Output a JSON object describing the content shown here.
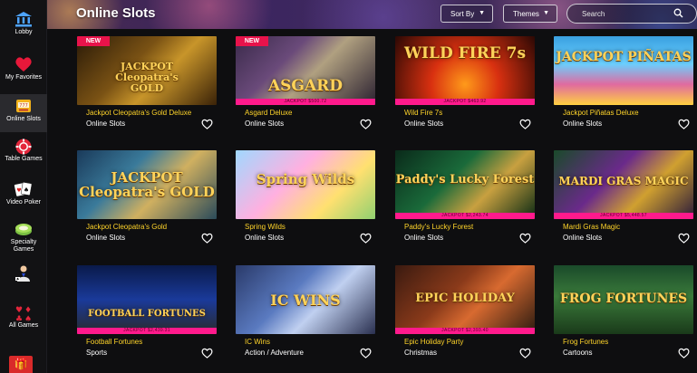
{
  "header": {
    "title": "Online Slots",
    "sort_label": "Sort By",
    "themes_label": "Themes",
    "search_placeholder": "Search"
  },
  "sidebar": {
    "items": [
      {
        "label": "Lobby",
        "icon": "bank-icon"
      },
      {
        "label": "My Favorites",
        "icon": "heart-icon"
      },
      {
        "label": "Online Slots",
        "icon": "slot-machine-icon",
        "active": true
      },
      {
        "label": "Table Games",
        "icon": "poker-chip-icon"
      },
      {
        "label": "Video Poker",
        "icon": "cards-icon"
      },
      {
        "label": "Specialty Games",
        "icon": "bingo-icon"
      },
      {
        "label": "",
        "icon": "live-dealer-icon"
      },
      {
        "label": "All Games",
        "icon": "card-suits-icon"
      }
    ]
  },
  "badges": {
    "new": "NEW"
  },
  "games": [
    {
      "name": "Jackpot Cleopatra's Gold Deluxe",
      "category": "Online Slots",
      "art": "JACKPOT\nCleopatra's\nGOLD",
      "new": true,
      "jackpot": ""
    },
    {
      "name": "Asgard Deluxe",
      "category": "Online Slots",
      "art": "ASGARD",
      "new": true,
      "jackpot": "JACKPOT $500.72"
    },
    {
      "name": "Wild Fire 7s",
      "category": "Online Slots",
      "art": "WILD FIRE 7s",
      "new": false,
      "jackpot": "JACKPOT $463.92"
    },
    {
      "name": "Jackpot Piñatas Deluxe",
      "category": "Online Slots",
      "art": "JACKPOT PIÑATAS",
      "new": false,
      "jackpot": ""
    },
    {
      "name": "Jackpot Cleopatra's Gold",
      "category": "Online Slots",
      "art": "JACKPOT Cleopatra's GOLD",
      "new": false,
      "jackpot": ""
    },
    {
      "name": "Spring Wilds",
      "category": "Online Slots",
      "art": "Spring Wilds",
      "new": false,
      "jackpot": ""
    },
    {
      "name": "Paddy's Lucky Forest",
      "category": "Online Slots",
      "art": "Paddy's Lucky Forest",
      "new": false,
      "jackpot": "JACKPOT $2,243.74"
    },
    {
      "name": "Mardi Gras Magic",
      "category": "Online Slots",
      "art": "MARDI GRAS MAGIC",
      "new": false,
      "jackpot": "JACKPOT $5,448.57"
    },
    {
      "name": "Football Fortunes",
      "category": "Sports",
      "art": "FOOTBALL FORTUNES",
      "new": false,
      "jackpot": "JACKPOT $2,439.31"
    },
    {
      "name": "IC Wins",
      "category": "Action / Adventure",
      "art": "IC WINS",
      "new": false,
      "jackpot": ""
    },
    {
      "name": "Epic Holiday Party",
      "category": "Christmas",
      "art": "EPIC HOLIDAY",
      "new": false,
      "jackpot": "JACKPOT $2,393.40"
    },
    {
      "name": "Frog Fortunes",
      "category": "Cartoons",
      "art": "FROG FORTUNES",
      "new": false,
      "jackpot": ""
    }
  ],
  "colors": {
    "accent_pink": "#ff1a8c",
    "new_badge": "#e8134b",
    "game_name_yellow": "#ffd42a"
  }
}
